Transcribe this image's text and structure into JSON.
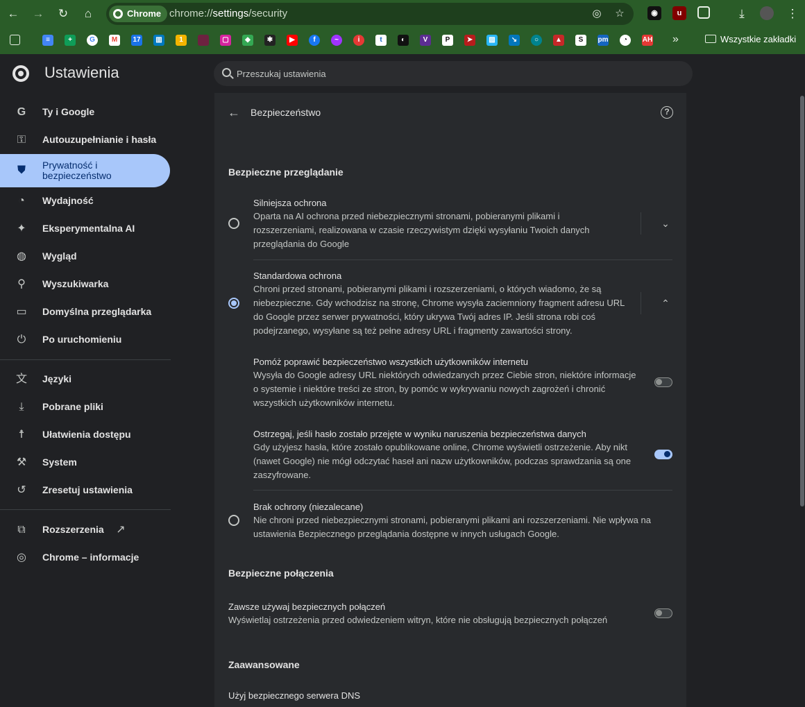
{
  "browser": {
    "chip_label": "Chrome",
    "url_prefix": "chrome://",
    "url_host": "settings",
    "url_path": "/security",
    "bookmarks_folder": "Wszystkie zakładki",
    "more_bookmarks": "»"
  },
  "header": {
    "title": "Ustawienia",
    "search_placeholder": "Przeszukaj ustawienia"
  },
  "sidebar": {
    "items": [
      {
        "label": "Ty i Google",
        "icon": "google-icon"
      },
      {
        "label": "Autouzupełnianie i hasła",
        "icon": "key-icon"
      },
      {
        "label": "Prywatność i bezpieczeństwo",
        "icon": "shield-icon"
      },
      {
        "label": "Wydajność",
        "icon": "gauge-icon"
      },
      {
        "label": "Eksperymentalna AI",
        "icon": "sparkle-icon"
      },
      {
        "label": "Wygląd",
        "icon": "palette-icon"
      },
      {
        "label": "Wyszukiwarka",
        "icon": "search-icon"
      },
      {
        "label": "Domyślna przeglądarka",
        "icon": "browser-window-icon"
      },
      {
        "label": "Po uruchomieniu",
        "icon": "power-icon"
      },
      {
        "label": "Języki",
        "icon": "translate-icon"
      },
      {
        "label": "Pobrane pliki",
        "icon": "download-icon"
      },
      {
        "label": "Ułatwienia dostępu",
        "icon": "accessibility-icon"
      },
      {
        "label": "System",
        "icon": "wrench-icon"
      },
      {
        "label": "Zresetuj ustawienia",
        "icon": "reset-icon"
      },
      {
        "label": "Rozszerzenia",
        "icon": "puzzle-icon"
      },
      {
        "label": "Chrome – informacje",
        "icon": "chrome-icon"
      }
    ]
  },
  "main": {
    "page_title": "Bezpieczeństwo",
    "safe_browsing": {
      "heading": "Bezpieczne przeglądanie",
      "enhanced": {
        "title": "Silniejsza ochrona",
        "desc": "Oparta na AI ochrona przed niebezpiecznymi stronami, pobieranymi plikami i rozszerzeniami, realizowana w czasie rzeczywistym dzięki wysyłaniu Twoich danych przeglądania do Google"
      },
      "standard": {
        "title": "Standardowa ochrona",
        "desc": "Chroni przed stronami, pobieranymi plikami i rozszerzeniami, o których wiadomo, że są niebezpieczne. Gdy wchodzisz na stronę, Chrome wysyła zaciemniony fragment adresu URL do Google przez serwer prywatności, który ukrywa Twój adres IP. Jeśli strona robi coś podejrzanego, wysyłane są też pełne adresy URL i fragmenty zawartości strony."
      },
      "help_improve": {
        "title": "Pomóż poprawić bezpieczeństwo wszystkich użytkowników internetu",
        "desc": "Wysyła do Google adresy URL niektórych odwiedzanych przez Ciebie stron, niektóre informacje o systemie i niektóre treści ze stron, by pomóc w wykrywaniu nowych zagrożeń i chronić wszystkich użytkowników internetu.",
        "enabled": false
      },
      "password_leak": {
        "title": "Ostrzegaj, jeśli hasło zostało przejęte w wyniku naruszenia bezpieczeństwa danych",
        "desc": "Gdy użyjesz hasła, które zostało opublikowane online, Chrome wyświetli ostrzeżenie. Aby nikt (nawet Google) nie mógł odczytać haseł ani nazw użytkowników, podczas sprawdzania są one zaszyfrowane.",
        "enabled": true
      },
      "none": {
        "title": "Brak ochrony (niezalecane)",
        "desc": "Nie chroni przed niebezpiecznymi stronami, pobieranymi plikami ani rozszerzeniami. Nie wpływa na ustawienia Bezpiecznego przeglądania dostępne w innych usługach Google."
      },
      "selected": "standard"
    },
    "secure_connections": {
      "heading": "Bezpieczne połączenia",
      "always_https": {
        "title": "Zawsze używaj bezpiecznych połączeń",
        "desc": "Wyświetlaj ostrzeżenia przed odwiedzeniem witryn, które nie obsługują bezpiecznych połączeń",
        "enabled": false
      }
    },
    "advanced": {
      "heading": "Zaawansowane",
      "secure_dns": {
        "title": "Użyj bezpiecznego serwera DNS"
      }
    }
  },
  "colors": {
    "frame": "#2a5c28",
    "accent": "#a8c7fa",
    "background": "#202124",
    "card": "#282a2d"
  }
}
